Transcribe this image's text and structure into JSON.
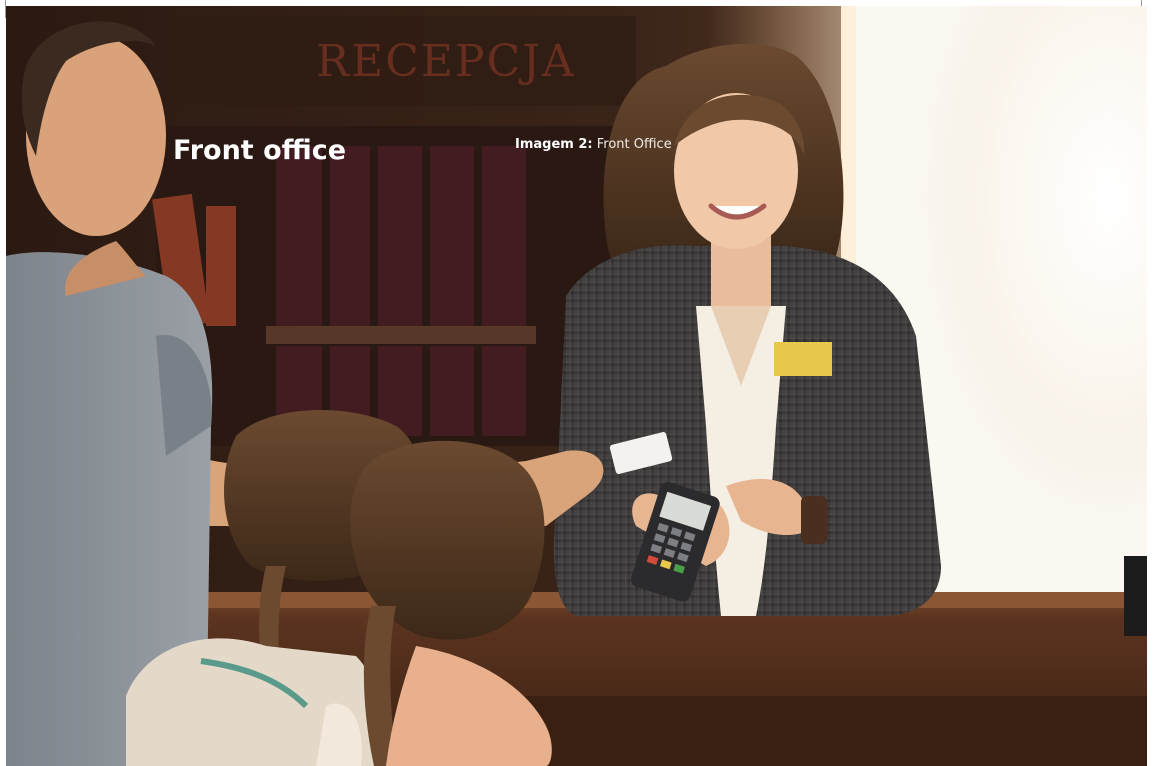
{
  "section_title": "Front office",
  "caption": {
    "label": "Imagem 2:",
    "text": "Front Office"
  },
  "photo": {
    "sign_text": "RECEPCJA",
    "colors": {
      "background_wood": "#3a2418",
      "counter_wood": "#5a3420",
      "window_light": "#fbf8f2",
      "blazer": "#3b3838",
      "name_badge": "#e8c84a",
      "tshirt": "#8b9097",
      "hair": "#5a3b25"
    }
  }
}
